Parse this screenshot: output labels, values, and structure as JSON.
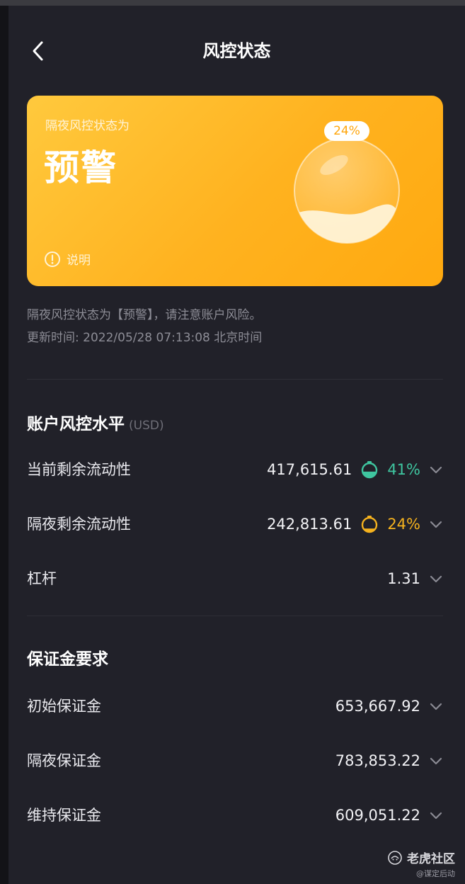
{
  "header": {
    "title": "风控状态"
  },
  "status_card": {
    "caption": "隔夜风控状态为",
    "status": "预警",
    "percent_label": "24%",
    "fill_fraction": 0.24,
    "explain_label": "说明",
    "color_from": "#ffc93d",
    "color_to": "#ffa90f"
  },
  "info": {
    "message": "隔夜风控状态为【预警】，请注意账户风险。",
    "updated": "更新时间: 2022/05/28 07:13:08 北京时间"
  },
  "risk_section": {
    "title": "账户风控水平",
    "unit": "(USD)",
    "rows": [
      {
        "label": "当前剩余流动性",
        "value": "417,615.61",
        "percent": "41%",
        "percent_fraction": 0.41,
        "color": "#3fc6a0"
      },
      {
        "label": "隔夜剩余流动性",
        "value": "242,813.61",
        "percent": "24%",
        "percent_fraction": 0.24,
        "color": "#f5b21e"
      },
      {
        "label": "杠杆",
        "value": "1.31"
      }
    ]
  },
  "margin_section": {
    "title": "保证金要求",
    "rows": [
      {
        "label": "初始保证金",
        "value": "653,667.92"
      },
      {
        "label": "隔夜保证金",
        "value": "783,853.22"
      },
      {
        "label": "维持保证金",
        "value": "609,051.22"
      }
    ]
  },
  "watermark": {
    "name": "老虎社区",
    "sub": "@谋定后动"
  },
  "icons": {
    "back": "chevron-left-icon",
    "info": "info-circle-icon",
    "expand": "chevron-down-icon",
    "gauge": "bubble-gauge-icon"
  }
}
